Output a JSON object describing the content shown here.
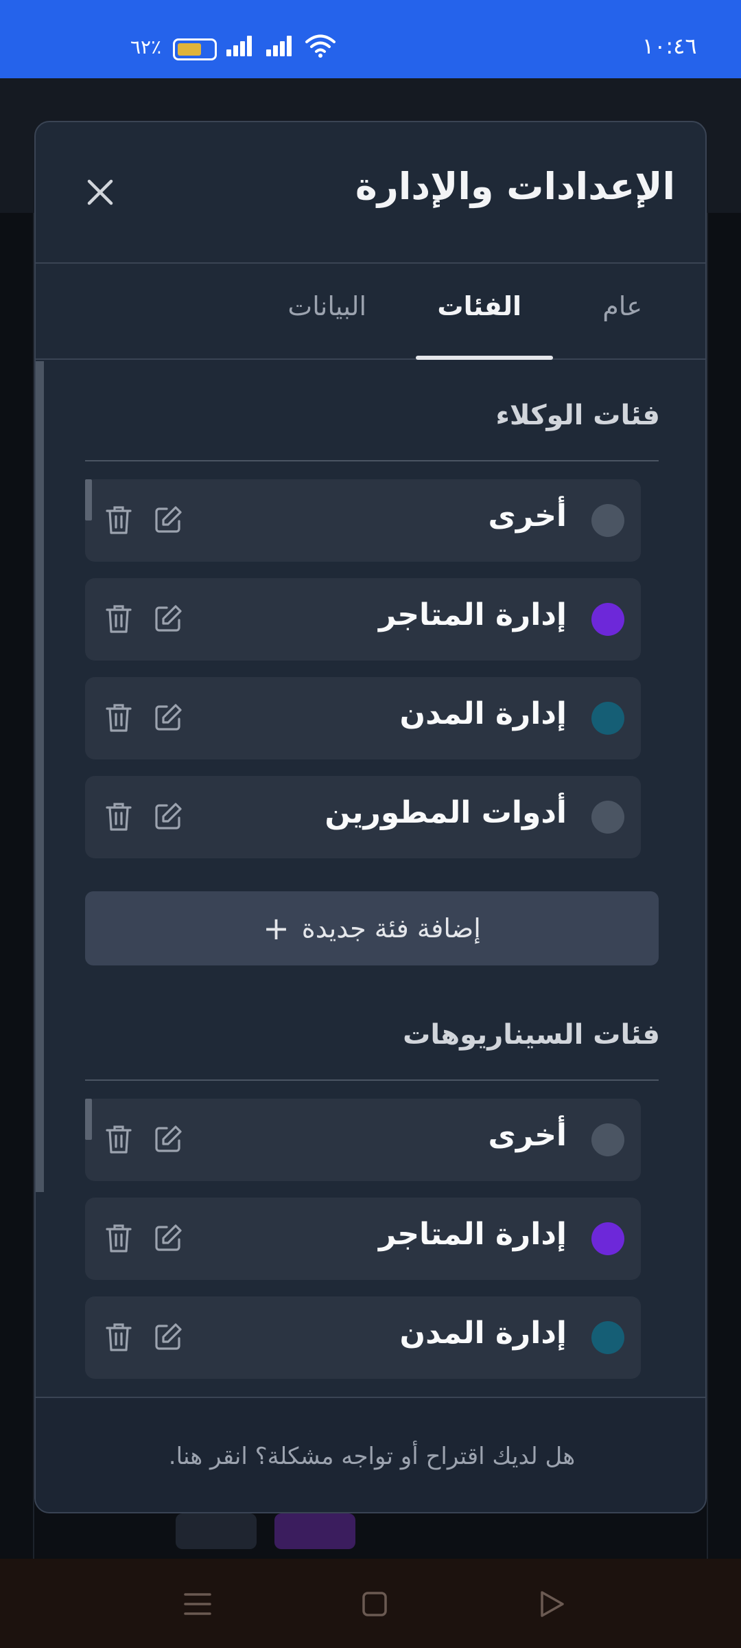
{
  "status_bar": {
    "time": "١٠:٤٦",
    "battery": "٦٢٪",
    "battery_level": 0.62
  },
  "modal": {
    "title": "الإعدادات والإدارة",
    "tabs": [
      {
        "label": "عام",
        "active": false
      },
      {
        "label": "الفئات",
        "active": true
      },
      {
        "label": "البيانات",
        "active": false
      }
    ],
    "agent_section": {
      "title": "فئات الوكلاء",
      "items": [
        {
          "label": "أخرى",
          "color": "#4b5563"
        },
        {
          "label": "إدارة المتاجر",
          "color": "#6d28d9"
        },
        {
          "label": "إدارة المدن",
          "color": "#155e75"
        },
        {
          "label": "أدوات المطورين",
          "color": "#4b5563"
        }
      ],
      "add_label": "إضافة فئة جديدة"
    },
    "scenario_section": {
      "title": "فئات السيناريوهات",
      "items": [
        {
          "label": "أخرى",
          "color": "#4b5563"
        },
        {
          "label": "إدارة المتاجر",
          "color": "#6d28d9"
        },
        {
          "label": "إدارة المدن",
          "color": "#155e75"
        }
      ]
    },
    "footer_link": "هل لديك اقتراح أو تواجه مشكلة؟ انقر هنا."
  }
}
